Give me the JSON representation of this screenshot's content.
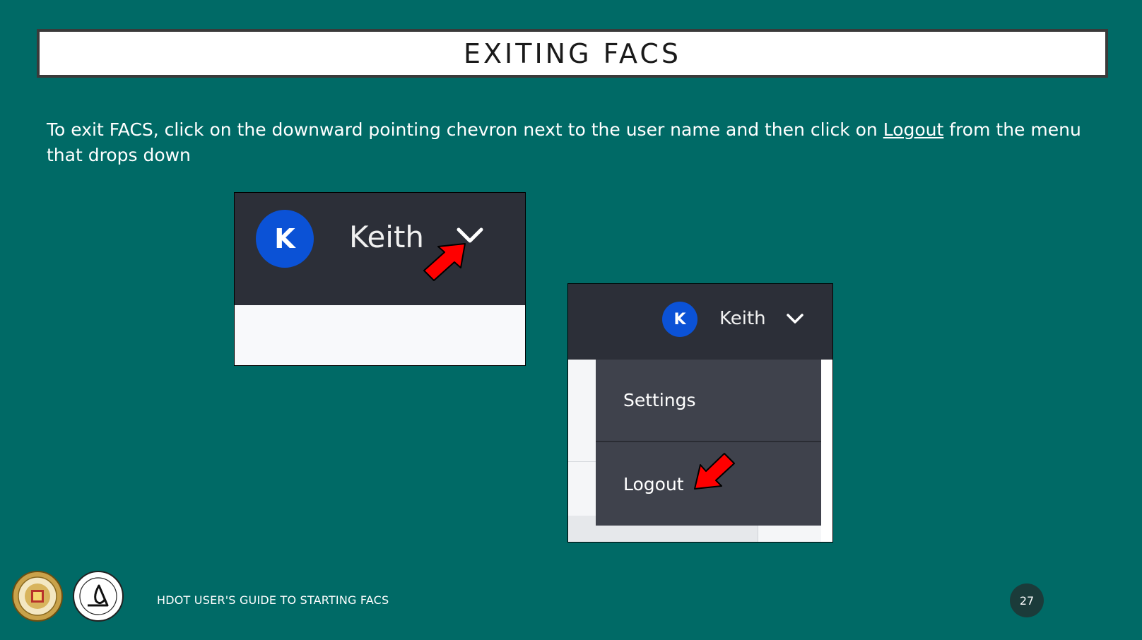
{
  "slide": {
    "title": "EXITING FACS",
    "instructions": {
      "before": "To exit FACS, click on the downward pointing chevron next to the user name and then click on ",
      "link_word": "Logout",
      "after": " from the menu that drops down"
    }
  },
  "screenshot_collapsed": {
    "avatar_letter": "K",
    "username": "Keith",
    "chevron_icon": "chevron-down-icon",
    "pointer_icon": "red-arrow-icon"
  },
  "screenshot_expanded": {
    "avatar_letter": "K",
    "username": "Keith",
    "chevron_icon": "chevron-down-icon",
    "menu": {
      "items": [
        {
          "label": "Settings"
        },
        {
          "label": "Logout"
        }
      ]
    },
    "pointer_icon": "red-arrow-icon"
  },
  "footer": {
    "guide_title": "HDOT USER'S GUIDE TO STARTING FACS",
    "page_number": "27",
    "logos": [
      "state-of-hawaii-seal",
      "department-of-transportation-logo"
    ]
  },
  "colors": {
    "background": "#006a66",
    "topbar": "#2c2f38",
    "avatar": "#0b52d6",
    "menu": "#3f424c",
    "arrow": "#ff0000"
  }
}
